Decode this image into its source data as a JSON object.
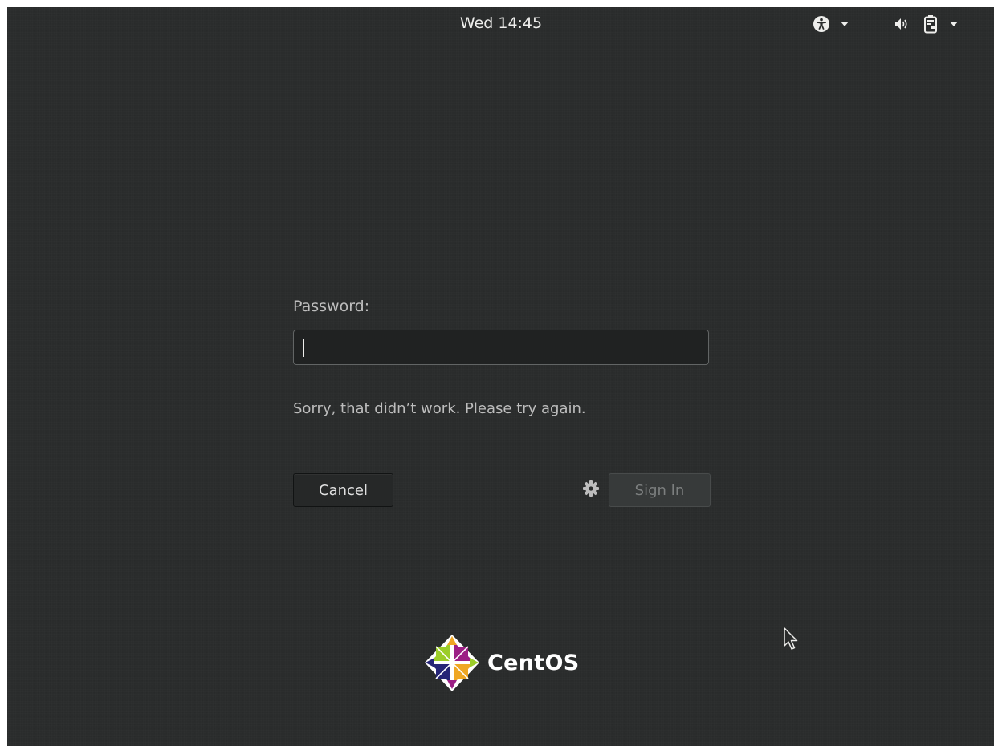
{
  "top_bar": {
    "clock": "Wed 14:45",
    "icons": [
      "accessibility-icon",
      "dropdown-arrow-icon",
      "volume-icon",
      "battery-icon",
      "dropdown-arrow-icon"
    ]
  },
  "login": {
    "password_label": "Password:",
    "password_value": "",
    "error_message": "Sorry, that didn’t work. Please try again.",
    "cancel_label": "Cancel",
    "sign_in_label": "Sign In",
    "session_icon": "gear-icon"
  },
  "branding": {
    "logo_text": "CentOS"
  },
  "colors": {
    "background": "#2a2c2c",
    "text": "#bdbdbd",
    "input_background": "#202222",
    "sign_in_disabled": "#7c7f7f",
    "logo_green": "#9ccd2a",
    "logo_orange": "#efa724",
    "logo_blue": "#262577",
    "logo_purple": "#9c1f85"
  }
}
